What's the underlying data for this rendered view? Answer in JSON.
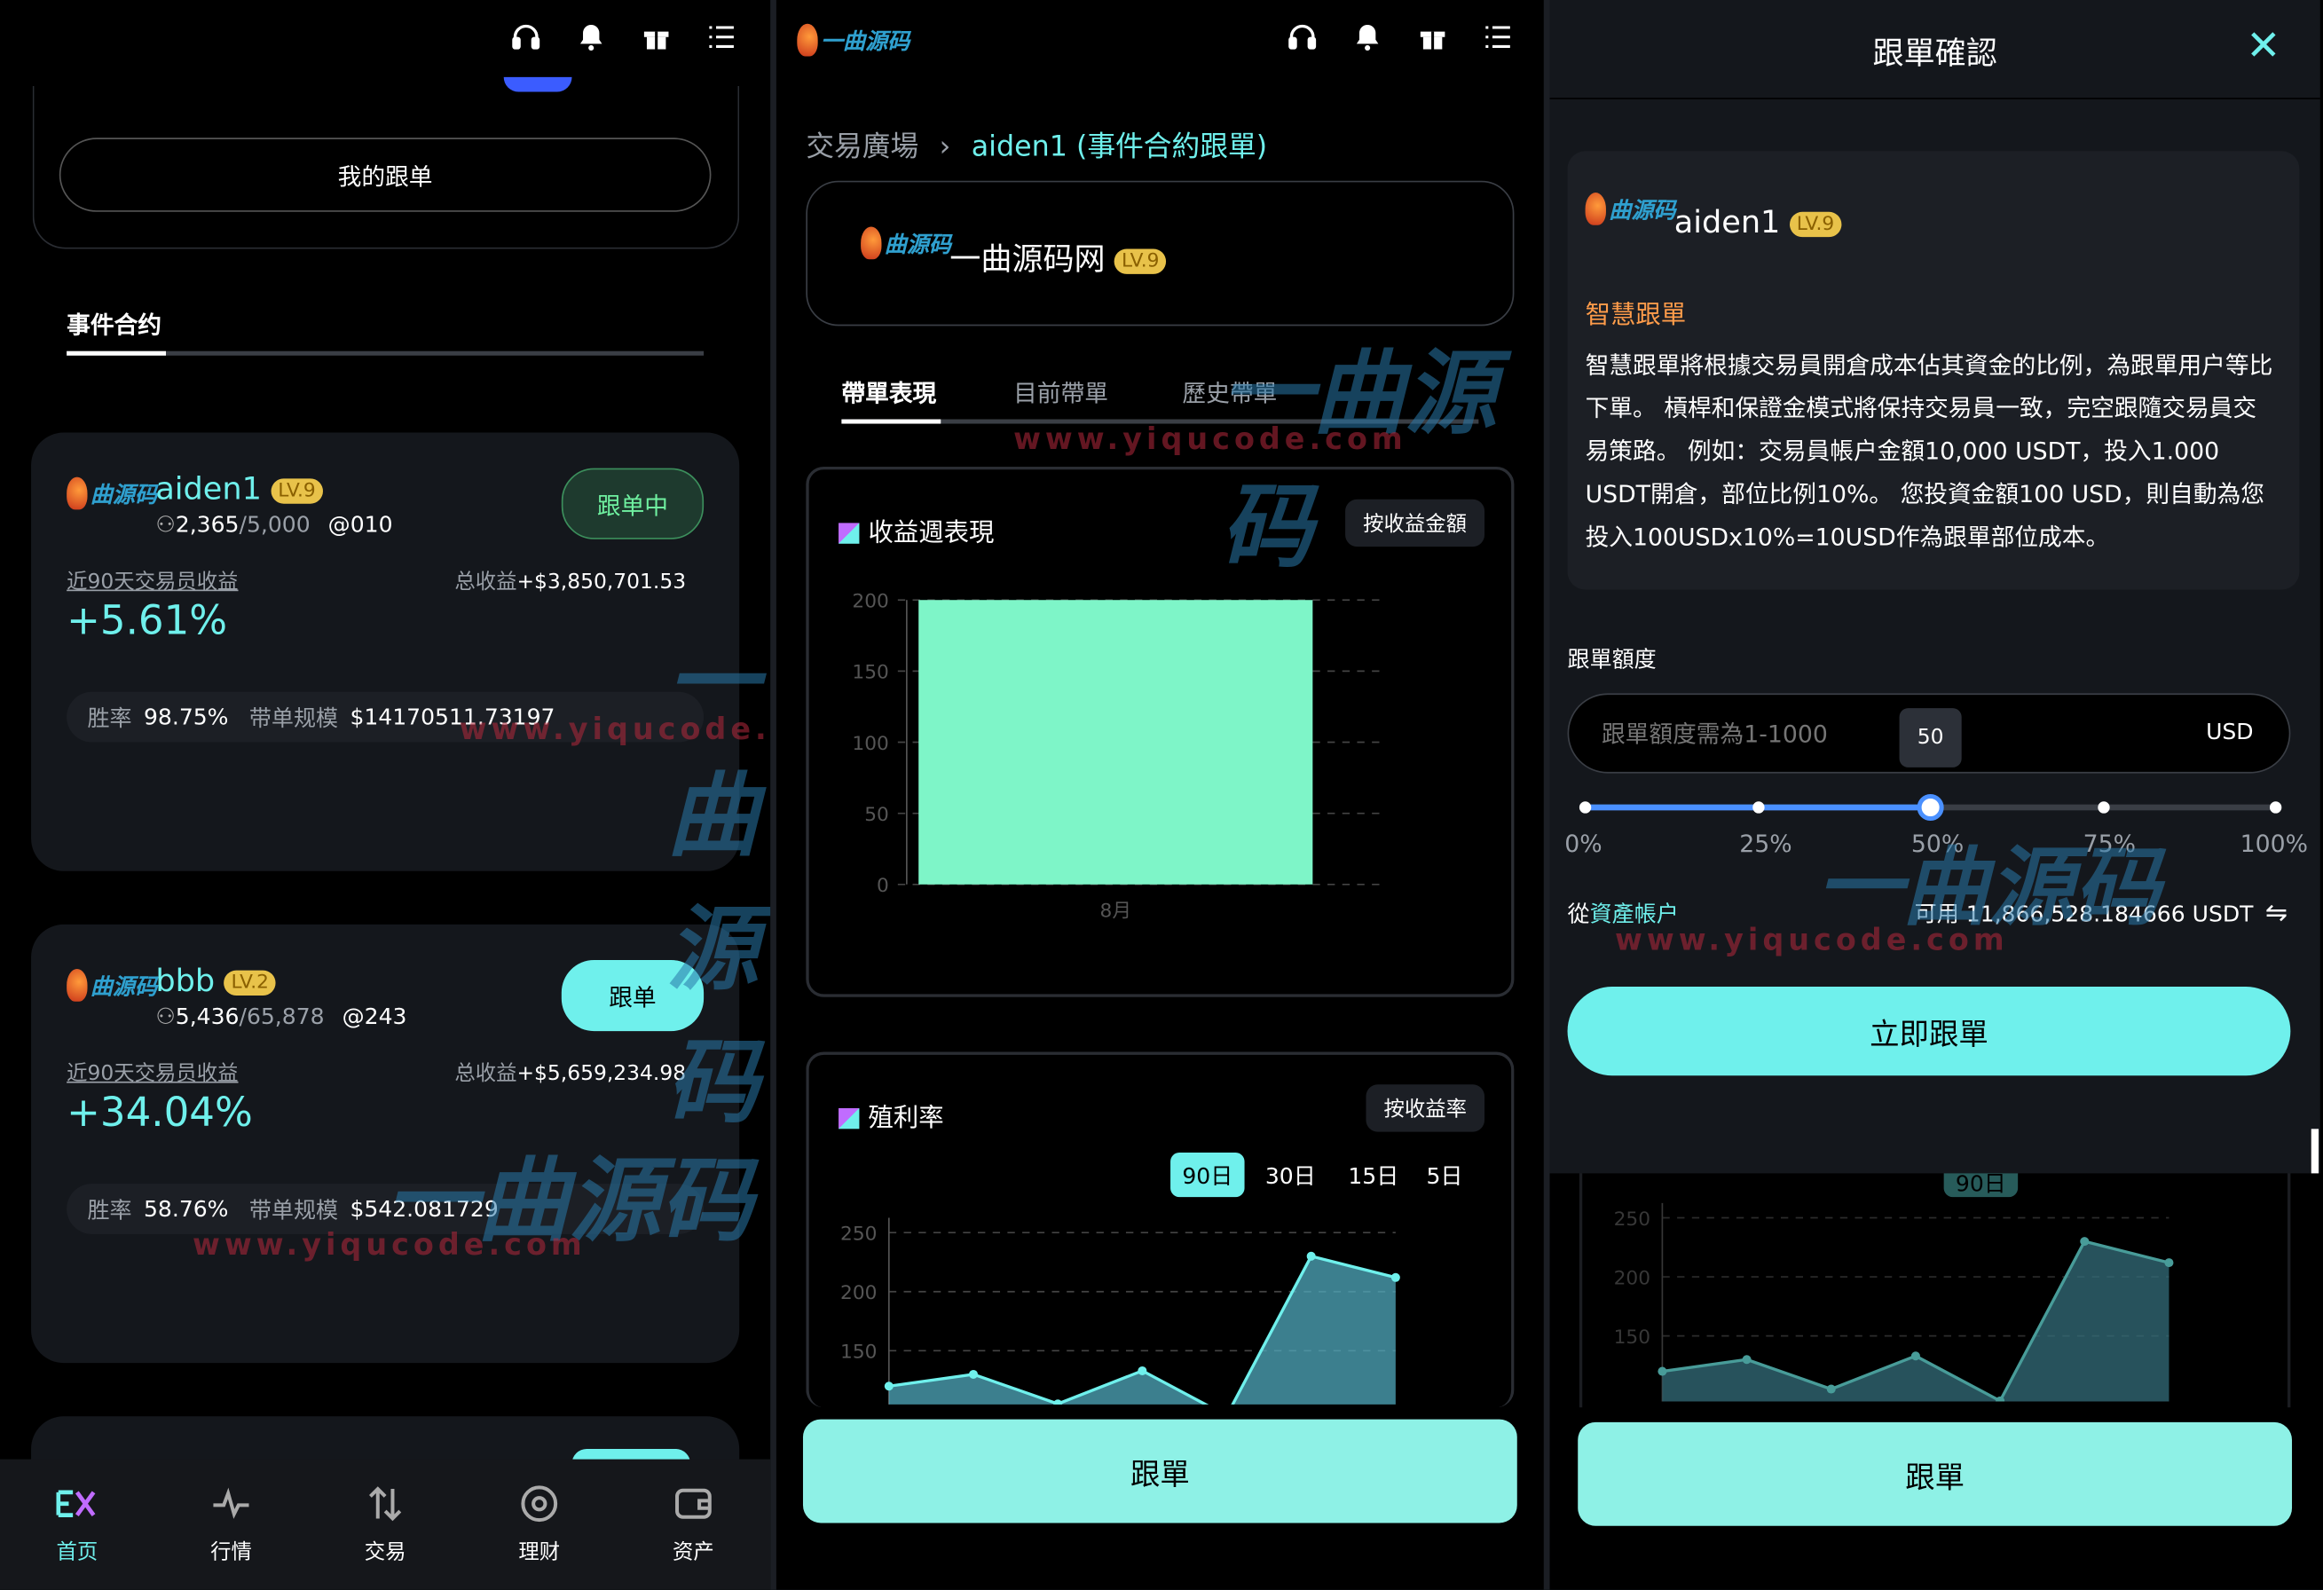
{
  "colors": {
    "accent": "#6ff0ec",
    "lv": "#e8c24a",
    "orange": "#ff9c4a",
    "button": "#8ef1e6"
  },
  "panel1": {
    "my_copy": "我的跟单",
    "tab": "事件合约",
    "traders": [
      {
        "name": "aiden1",
        "level": "LV.9",
        "followers": "2,365",
        "max": "/5,000",
        "id": "@010",
        "status": "跟单中",
        "period_label": "近90天交易员收益",
        "total_label": "总收益",
        "total": "+$3,850,701.53",
        "pct": "+5.61%",
        "win_label": "胜率",
        "win": "98.75%",
        "scale_label": "带单规模",
        "scale": "$14170511.73197"
      },
      {
        "name": "bbb",
        "level": "LV.2",
        "followers": "5,436",
        "max": "/65,878",
        "id": "@243",
        "status": "跟单",
        "period_label": "近90天交易员收益",
        "total_label": "总收益",
        "total": "+$5,659,234.98",
        "pct": "+34.04%",
        "win_label": "胜率",
        "win": "58.76%",
        "scale_label": "带单规模",
        "scale": "$542.081729"
      }
    ],
    "nav": [
      "首页",
      "行情",
      "交易",
      "理财",
      "资产"
    ]
  },
  "panel2": {
    "crumb_root": "交易廣場",
    "crumb_cur": "aiden1 (事件合約跟單)",
    "brand": "一曲源码网",
    "level": "LV.9",
    "tabs": [
      "帶單表現",
      "目前帶單",
      "歷史帶單"
    ],
    "chart1_title": "收益週表現",
    "chart1_btn": "按收益金額",
    "chart2_title": "殖利率",
    "chart2_btn": "按收益率",
    "ranges": [
      "90日",
      "30日",
      "15日",
      "5日"
    ],
    "follow": "跟單"
  },
  "chart_data": [
    {
      "type": "bar",
      "title": "收益週表現",
      "categories": [
        "8月"
      ],
      "values": [
        200
      ],
      "ylim": [
        0,
        200
      ],
      "yticks": [
        0,
        50,
        100,
        150,
        200
      ]
    },
    {
      "type": "area",
      "title": "殖利率",
      "x": [
        1,
        2,
        3,
        4,
        5,
        6,
        7
      ],
      "values": [
        120,
        130,
        105,
        133,
        95,
        230,
        212
      ],
      "yticks": [
        150,
        200,
        250
      ],
      "ylim": [
        100,
        250
      ]
    }
  ],
  "panel3": {
    "title": "跟單確認",
    "name": "aiden1",
    "level": "LV.9",
    "smart_title": "智慧跟單",
    "smart_desc": "智慧跟單將根據交易員開倉成本佔其資金的比例，為跟單用户等比下單。 槓桿和保證金模式將保持交易員一致，完空跟隨交易員交易策路。 例如：交易員帳户金額10,000 USDT，投入1.000 USDT開倉，部位比例10%。 您投資金額100 USD，則自動為您投入100USDx10%=10USD作為跟單部位成本。",
    "amount_label": "跟單額度",
    "placeholder": "跟單額度需為1-1000",
    "unit": "USD",
    "slider_value": "50",
    "slider_fraction": 0.5,
    "ticks": [
      "0%",
      "25%",
      "50%",
      "75%",
      "100%"
    ],
    "from": "從",
    "from_link": "資產帳户",
    "available": "可用 11,866,528.184666 USDT",
    "submit": "立即跟單",
    "follow": "跟單"
  }
}
